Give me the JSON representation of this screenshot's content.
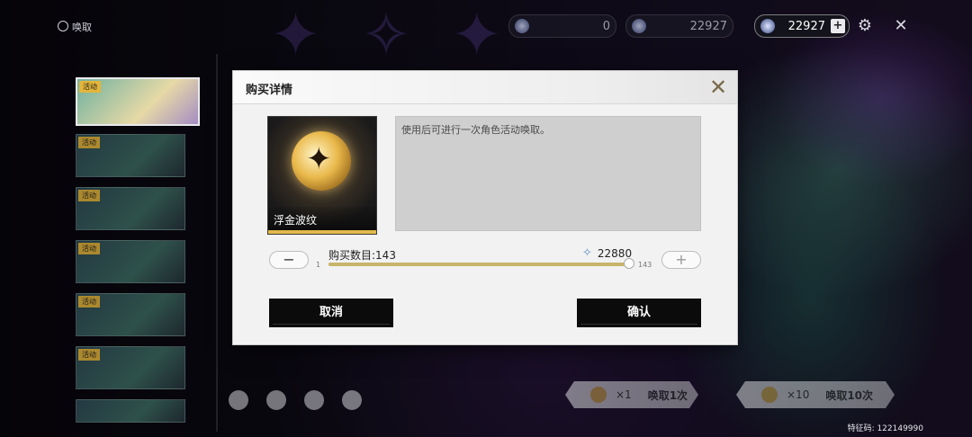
{
  "top_bar": {
    "tab_label": "唤取",
    "currencies": [
      {
        "value": "0",
        "icon": "coin-icon"
      },
      {
        "value": "22927",
        "icon": "star-crystal-icon"
      },
      {
        "value": "22927",
        "icon": "star-crystal-icon",
        "plus": "+"
      }
    ]
  },
  "side_list": {
    "tag": "活动"
  },
  "dialog": {
    "title": "购买详情",
    "item_name": "浮金波纹",
    "description": "使用后可进行一次角色活动唤取。",
    "quantity_label": "购买数目:",
    "quantity": "143",
    "cost": "22880",
    "slider": {
      "min": "1",
      "max": "143",
      "value_fraction": 1.0
    },
    "minus_label": "−",
    "plus_label": "+",
    "cancel_label": "取消",
    "confirm_label": "确认"
  },
  "gacha_buttons": [
    {
      "count": "×1",
      "label": "唤取1次"
    },
    {
      "count": "×10",
      "label": "唤取10次"
    }
  ],
  "feature_code": "特征码: 122149990",
  "colors": {
    "accent_gold": "#e2b94a",
    "button_dark": "#0b0b0b",
    "dialog_bg": "#f2f2f2"
  }
}
